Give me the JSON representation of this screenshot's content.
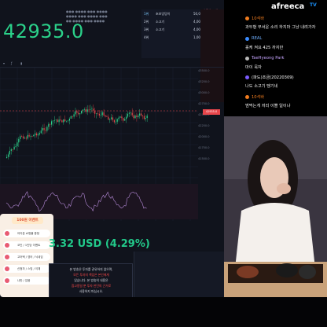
{
  "ticker": {
    "price_big": "42935.0",
    "usd_price": "3.32 USD (4.29%)"
  },
  "orderbook": {
    "rows": [
      {
        "rank": "1위",
        "name": "초보엉덩이",
        "amount": "50,000원"
      },
      {
        "rank": "2위",
        "name": "소고기",
        "amount": "4,000원"
      },
      {
        "rank": "3위",
        "name": "소고기",
        "amount": "4,000원"
      },
      {
        "rank": "4위",
        "name": "",
        "amount": "1,000원"
      }
    ],
    "header": "나도요 조아"
  },
  "chart": {
    "current_price_tag": "42935.0",
    "axis_ticks": [
      "43500.0",
      "43250.0",
      "43000.0",
      "42750.0",
      "42500.0",
      "42250.0",
      "42000.0",
      "41750.0",
      "41500.0"
    ],
    "accent_green": "#2bd18a",
    "accent_red": "#e8464b"
  },
  "event": {
    "title": "100원 이벤트",
    "items": [
      "아이폰 쇼핑몰 증정",
      "코인 / 1인당 이벤트",
      "고어텍 / 영어 / 닉네임",
      "신청자 / 스밍 / 이체",
      "나만 / 있음"
    ]
  },
  "notice": {
    "lines": [
      "본 방송은 투자를 권유하지 않으며,",
      "모든 투자의 책임은 본인에게",
      "있습니다. 본 방송의 내용은",
      "참고용일 뿐 투자 판단의 근거로",
      "사용하지 마십시오."
    ]
  },
  "chat": {
    "logo": "afreeca",
    "logo_tv": "TV",
    "messages": [
      {
        "user": "10석바",
        "text": "과두형 무서운 소리 하지마 그냥 내려가자",
        "badge_color": "#f07c1f"
      },
      {
        "user": "REAL",
        "text": "홀케 켜요 425 까지만",
        "badge_color": "#3b8cff"
      },
      {
        "user": "TaeHyeong Park",
        "text": "마이 묵자",
        "badge_color": "#b9b9b9"
      },
      {
        "user": "(파도)조금(20220309)",
        "text": "나도 소고기 땡기네",
        "badge_color": "#7c5cff"
      },
      {
        "user": "10석바",
        "text": "범먹는게 저리 이쁠 일이냐",
        "badge_color": "#f07c1f"
      }
    ]
  }
}
